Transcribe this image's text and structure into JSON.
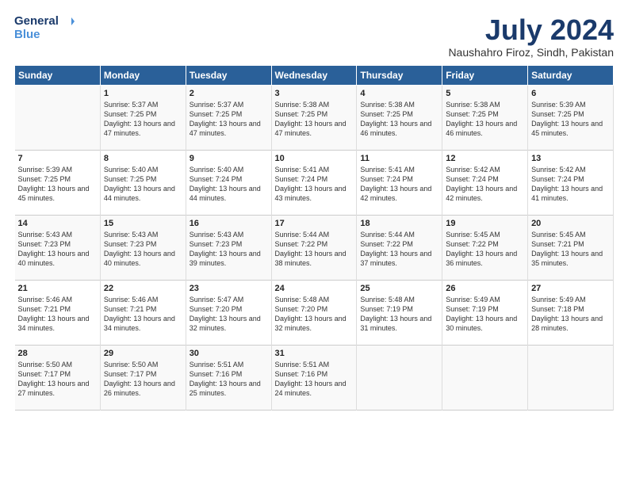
{
  "logo": {
    "line1": "General",
    "line2": "Blue"
  },
  "title": "July 2024",
  "subtitle": "Naushahro Firoz, Sindh, Pakistan",
  "header": {
    "days": [
      "Sunday",
      "Monday",
      "Tuesday",
      "Wednesday",
      "Thursday",
      "Friday",
      "Saturday"
    ]
  },
  "weeks": [
    [
      {
        "day": "",
        "info": ""
      },
      {
        "day": "1",
        "info": "Sunrise: 5:37 AM\nSunset: 7:25 PM\nDaylight: 13 hours\nand 47 minutes."
      },
      {
        "day": "2",
        "info": "Sunrise: 5:37 AM\nSunset: 7:25 PM\nDaylight: 13 hours\nand 47 minutes."
      },
      {
        "day": "3",
        "info": "Sunrise: 5:38 AM\nSunset: 7:25 PM\nDaylight: 13 hours\nand 47 minutes."
      },
      {
        "day": "4",
        "info": "Sunrise: 5:38 AM\nSunset: 7:25 PM\nDaylight: 13 hours\nand 46 minutes."
      },
      {
        "day": "5",
        "info": "Sunrise: 5:38 AM\nSunset: 7:25 PM\nDaylight: 13 hours\nand 46 minutes."
      },
      {
        "day": "6",
        "info": "Sunrise: 5:39 AM\nSunset: 7:25 PM\nDaylight: 13 hours\nand 45 minutes."
      }
    ],
    [
      {
        "day": "7",
        "info": "Sunrise: 5:39 AM\nSunset: 7:25 PM\nDaylight: 13 hours\nand 45 minutes."
      },
      {
        "day": "8",
        "info": "Sunrise: 5:40 AM\nSunset: 7:25 PM\nDaylight: 13 hours\nand 44 minutes."
      },
      {
        "day": "9",
        "info": "Sunrise: 5:40 AM\nSunset: 7:24 PM\nDaylight: 13 hours\nand 44 minutes."
      },
      {
        "day": "10",
        "info": "Sunrise: 5:41 AM\nSunset: 7:24 PM\nDaylight: 13 hours\nand 43 minutes."
      },
      {
        "day": "11",
        "info": "Sunrise: 5:41 AM\nSunset: 7:24 PM\nDaylight: 13 hours\nand 42 minutes."
      },
      {
        "day": "12",
        "info": "Sunrise: 5:42 AM\nSunset: 7:24 PM\nDaylight: 13 hours\nand 42 minutes."
      },
      {
        "day": "13",
        "info": "Sunrise: 5:42 AM\nSunset: 7:24 PM\nDaylight: 13 hours\nand 41 minutes."
      }
    ],
    [
      {
        "day": "14",
        "info": "Sunrise: 5:43 AM\nSunset: 7:23 PM\nDaylight: 13 hours\nand 40 minutes."
      },
      {
        "day": "15",
        "info": "Sunrise: 5:43 AM\nSunset: 7:23 PM\nDaylight: 13 hours\nand 40 minutes."
      },
      {
        "day": "16",
        "info": "Sunrise: 5:43 AM\nSunset: 7:23 PM\nDaylight: 13 hours\nand 39 minutes."
      },
      {
        "day": "17",
        "info": "Sunrise: 5:44 AM\nSunset: 7:22 PM\nDaylight: 13 hours\nand 38 minutes."
      },
      {
        "day": "18",
        "info": "Sunrise: 5:44 AM\nSunset: 7:22 PM\nDaylight: 13 hours\nand 37 minutes."
      },
      {
        "day": "19",
        "info": "Sunrise: 5:45 AM\nSunset: 7:22 PM\nDaylight: 13 hours\nand 36 minutes."
      },
      {
        "day": "20",
        "info": "Sunrise: 5:45 AM\nSunset: 7:21 PM\nDaylight: 13 hours\nand 35 minutes."
      }
    ],
    [
      {
        "day": "21",
        "info": "Sunrise: 5:46 AM\nSunset: 7:21 PM\nDaylight: 13 hours\nand 34 minutes."
      },
      {
        "day": "22",
        "info": "Sunrise: 5:46 AM\nSunset: 7:21 PM\nDaylight: 13 hours\nand 34 minutes."
      },
      {
        "day": "23",
        "info": "Sunrise: 5:47 AM\nSunset: 7:20 PM\nDaylight: 13 hours\nand 32 minutes."
      },
      {
        "day": "24",
        "info": "Sunrise: 5:48 AM\nSunset: 7:20 PM\nDaylight: 13 hours\nand 32 minutes."
      },
      {
        "day": "25",
        "info": "Sunrise: 5:48 AM\nSunset: 7:19 PM\nDaylight: 13 hours\nand 31 minutes."
      },
      {
        "day": "26",
        "info": "Sunrise: 5:49 AM\nSunset: 7:19 PM\nDaylight: 13 hours\nand 30 minutes."
      },
      {
        "day": "27",
        "info": "Sunrise: 5:49 AM\nSunset: 7:18 PM\nDaylight: 13 hours\nand 28 minutes."
      }
    ],
    [
      {
        "day": "28",
        "info": "Sunrise: 5:50 AM\nSunset: 7:17 PM\nDaylight: 13 hours\nand 27 minutes."
      },
      {
        "day": "29",
        "info": "Sunrise: 5:50 AM\nSunset: 7:17 PM\nDaylight: 13 hours\nand 26 minutes."
      },
      {
        "day": "30",
        "info": "Sunrise: 5:51 AM\nSunset: 7:16 PM\nDaylight: 13 hours\nand 25 minutes."
      },
      {
        "day": "31",
        "info": "Sunrise: 5:51 AM\nSunset: 7:16 PM\nDaylight: 13 hours\nand 24 minutes."
      },
      {
        "day": "",
        "info": ""
      },
      {
        "day": "",
        "info": ""
      },
      {
        "day": "",
        "info": ""
      }
    ]
  ]
}
